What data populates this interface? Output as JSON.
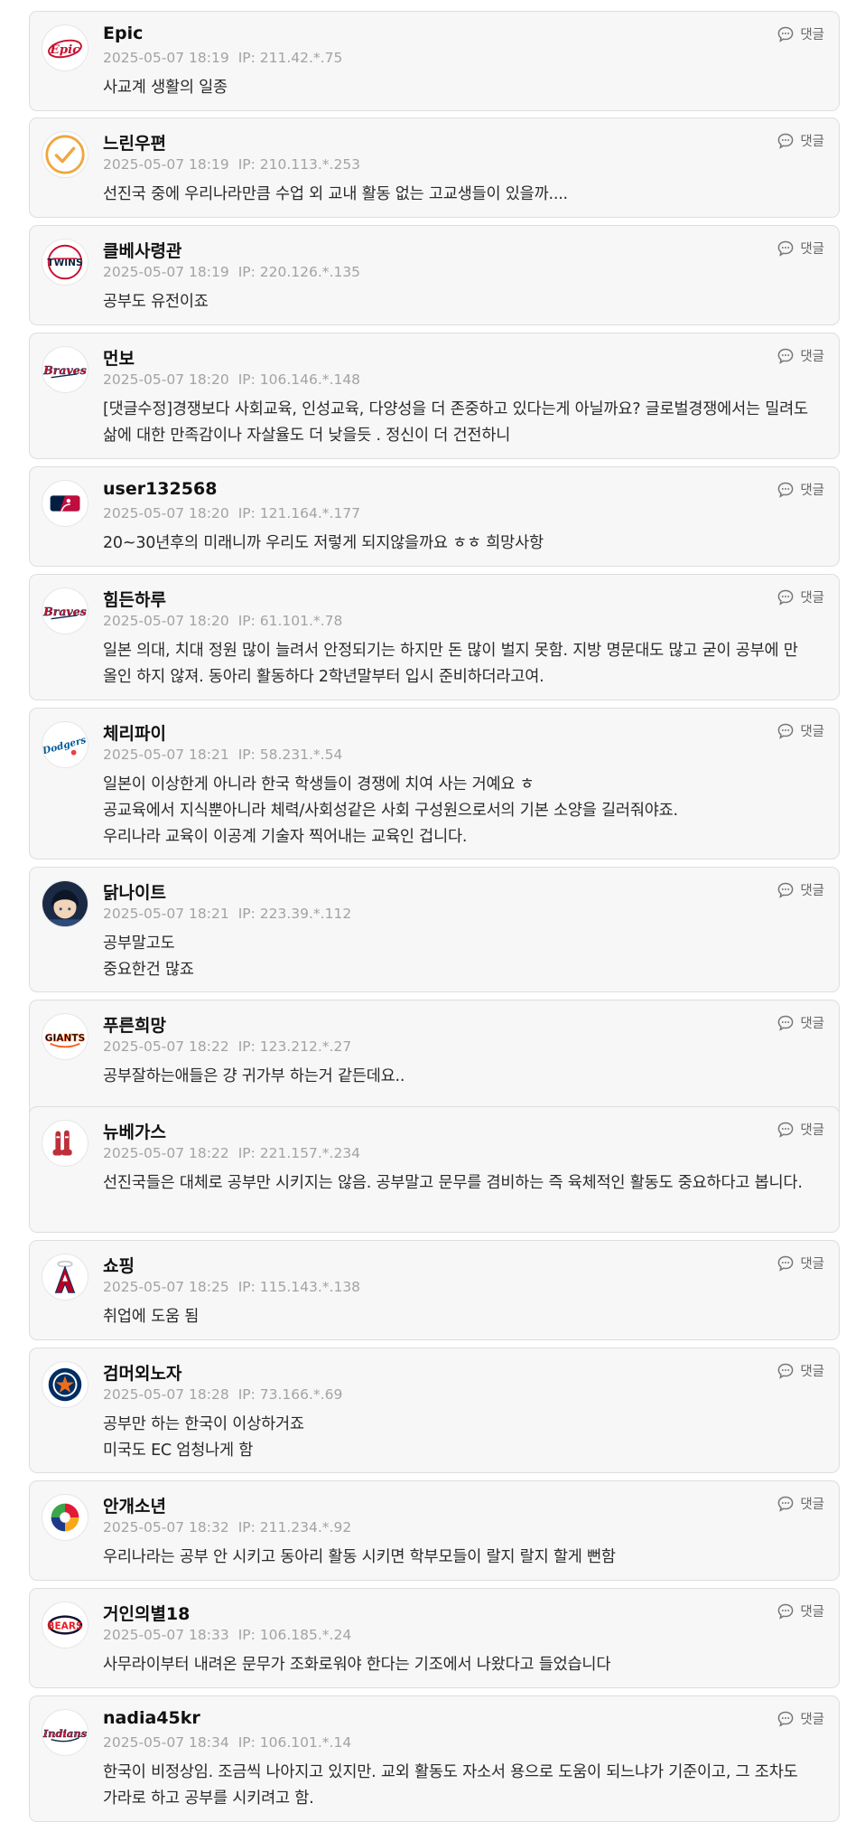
{
  "reply_label": "댓글",
  "comments": [
    {
      "nick": "Epic",
      "date": "2025-05-07 18:19",
      "ip": "IP: 211.42.*.75",
      "body": "사교계 생활의 일종",
      "avatar": "epic-logo-icon"
    },
    {
      "nick": "느린우편",
      "date": "2025-05-07 18:19",
      "ip": "IP: 210.113.*.253",
      "body": "선진국 중에 우리나라만큼 수업 외 교내 활동 없는 고교생들이 있을까....",
      "avatar": "checkmark-icon"
    },
    {
      "nick": "클베사령관",
      "date": "2025-05-07 18:19",
      "ip": "IP: 220.126.*.135",
      "body": "공부도 유전이죠",
      "avatar": "twins-logo-icon"
    },
    {
      "nick": "먼보",
      "date": "2025-05-07 18:20",
      "ip": "IP: 106.146.*.148",
      "body": "[댓글수정]경쟁보다 사회교육, 인성교육, 다양성을 더 존중하고 있다는게 아닐까요? 글로벌경쟁에서는 밀려도 삶에 대한 만족감이나 자살율도 더 낮을듯 . 정신이 더 건전하니",
      "avatar": "braves-logo-icon"
    },
    {
      "nick": "user132568",
      "date": "2025-05-07 18:20",
      "ip": "IP: 121.164.*.177",
      "body": "20~30년후의 미래니까 우리도 저렇게 되지않을까요 ㅎㅎ 희망사항",
      "avatar": "mlb-logo-icon"
    },
    {
      "nick": "힘든하루",
      "date": "2025-05-07 18:20",
      "ip": "IP: 61.101.*.78",
      "body": "일본 의대, 치대 정원 많이 늘려서 안정되기는 하지만 돈 많이 벌지 못함. 지방 명문대도 많고 굳이 공부에 만 올인 하지 않져. 동아리 활동하다 2학년말부터 입시 준비하더라고여.",
      "avatar": "braves-logo-icon"
    },
    {
      "nick": "체리파이",
      "date": "2025-05-07 18:21",
      "ip": "IP: 58.231.*.54",
      "body": "일본이 이상한게 아니라 한국 학생들이 경쟁에 치여 사는 거예요 ㅎ\n공교육에서 지식뿐아니라 체력/사회성같은 사회 구성원으로서의 기본 소양을 길러줘야죠.\n우리나라 교육이 이공계 기술자 찍어내는 교육인 겁니다.",
      "avatar": "dodgers-logo-icon"
    },
    {
      "nick": "닭나이트",
      "date": "2025-05-07 18:21",
      "ip": "IP: 223.39.*.112",
      "body": "공부말고도\n중요한건 많죠",
      "avatar": "anime-avatar-icon"
    },
    {
      "nick": "푸른희망",
      "date": "2025-05-07 18:22",
      "ip": "IP: 123.212.*.27",
      "body": "공부잘하는애들은 걍 귀가부 하는거 같든데요..",
      "avatar": "giants-logo-icon"
    },
    {
      "nick": "뉴베가스",
      "date": "2025-05-07 18:22",
      "ip": "IP: 221.157.*.234",
      "body": "선진국들은 대체로 공부만 시키지는 않음. 공부말고 문무를 겸비하는 즉 육체적인 활동도 중요하다고 봅니다.",
      "avatar": "red-sox-logo-icon"
    },
    {
      "nick": "쇼핑",
      "date": "2025-05-07 18:25",
      "ip": "IP: 115.143.*.138",
      "body": "취업에 도움 됨",
      "avatar": "angels-logo-icon"
    },
    {
      "nick": "검머외노자",
      "date": "2025-05-07 18:28",
      "ip": "IP: 73.166.*.69",
      "body": "공부만 하는 한국이 이상하거죠\n미국도 EC 엄청나게 함",
      "avatar": "astros-logo-icon"
    },
    {
      "nick": "안개소년",
      "date": "2025-05-07 18:32",
      "ip": "IP: 211.234.*.92",
      "body": "우리나라는 공부 안 시키고 동아리 활동 시키면 학부모들이 랄지 랄지 할게 뻔함",
      "avatar": "kbo-logo-icon"
    },
    {
      "nick": "거인의별18",
      "date": "2025-05-07 18:33",
      "ip": "IP: 106.185.*.24",
      "body": "사무라이부터 내려온 문무가 조화로워야 한다는 기조에서 나왔다고 들었습니다",
      "avatar": "bears-logo-icon"
    },
    {
      "nick": "nadia45kr",
      "date": "2025-05-07 18:34",
      "ip": "IP: 106.101.*.14",
      "body": "한국이 비정상임. 조금씩 나아지고 있지만. 교외 활동도 자소서 용으로 도움이 되느냐가 기준이고, 그 조차도 가라로 하고 공부를 시키려고 함.",
      "avatar": "indians-logo-icon"
    }
  ]
}
